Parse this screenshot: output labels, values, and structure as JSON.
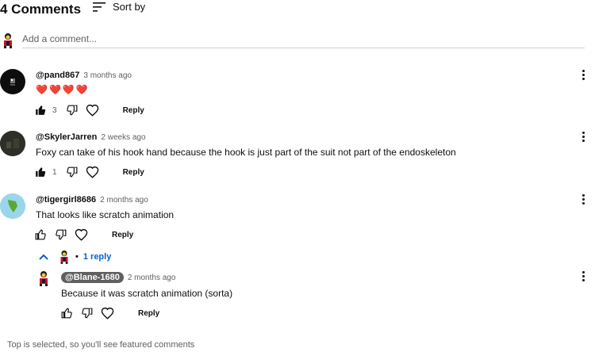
{
  "header": {
    "title": "4 Comments",
    "sort_label": "Sort by"
  },
  "add_comment": {
    "placeholder": "Add a comment..."
  },
  "comments": [
    {
      "handle": "@pand867",
      "time": "3 months ago",
      "text": "❤️❤️❤️❤️",
      "likes": "3",
      "liked": true,
      "reply_label": "Reply"
    },
    {
      "handle": "@SkylerJarren",
      "time": "2 weeks ago",
      "text": "Foxy can take of his hook hand because the hook is just part of the suit not part of the endoskeleton",
      "likes": "1",
      "liked": true,
      "reply_label": "Reply"
    },
    {
      "handle": "@tigergirl8686",
      "time": "2 months ago",
      "text": "That looks like scratch animation",
      "likes": "",
      "liked": false,
      "reply_label": "Reply"
    }
  ],
  "replies_toggle": {
    "label": "1 reply",
    "separator": "•"
  },
  "reply": {
    "handle": "@Blane-1680",
    "time": "2 months ago",
    "text": "Because it was scratch animation (sorta)",
    "reply_label": "Reply"
  },
  "footer": {
    "text": "Top is selected, so you'll see featured comments"
  },
  "colors": {
    "link_blue": "#065fd4",
    "secondary_text": "#606060",
    "heart_red": "#e0245e"
  },
  "icons": [
    "sort-icon",
    "thumbs-up-icon",
    "thumbs-down-icon",
    "heart-icon",
    "kebab-menu-icon",
    "chevron-up-icon"
  ]
}
